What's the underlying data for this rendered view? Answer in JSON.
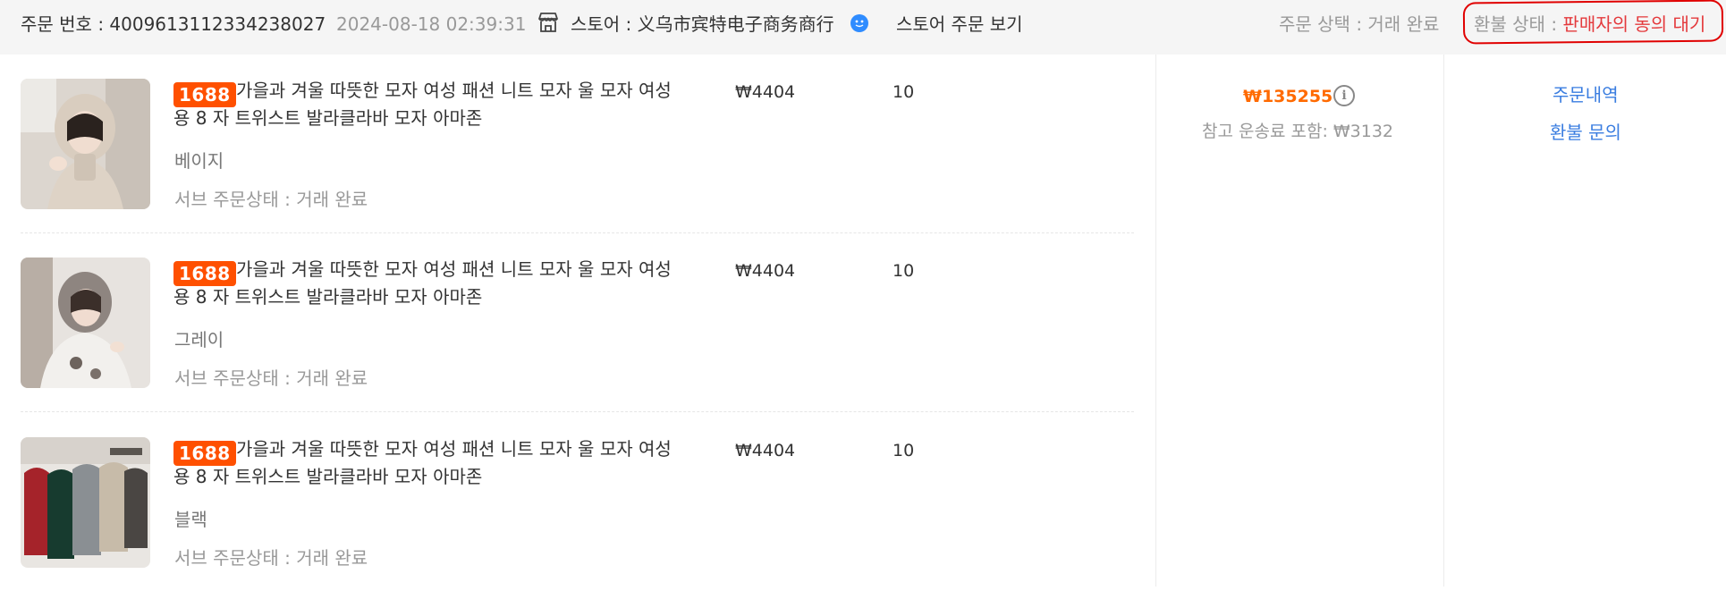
{
  "header": {
    "order_no": "주문 번호 : 4009613112334238027",
    "order_time": "2024-08-18 02:39:31",
    "store_prefix": "스토어 : ",
    "store_name": "义乌市宾特电子商务商行",
    "view_store_orders": "스토어 주문 보기",
    "order_status": "주문 상택 : 거래 완료",
    "refund_status_label": "환불 상태 : ",
    "refund_status_value": "판매자의 동의 대기",
    "icons": {
      "store": "store-icon",
      "chat": "chat-icon"
    },
    "colors": {
      "refund_value": "#e4393c",
      "highlight_ring": "#e00000"
    }
  },
  "items": [
    {
      "badge": "1688",
      "title": "가을과 겨울 따뜻한 모자 여성 패션 니트 모자 울 모자 여성용 8 자 트위스트 발라클라바 모자 아마존",
      "price": "₩4404",
      "qty": "10",
      "variant": "베이지",
      "sub_status": "서브 주문상태 : 거래 완료"
    },
    {
      "badge": "1688",
      "title": "가을과 겨울 따뜻한 모자 여성 패션 니트 모자 울 모자 여성용 8 자 트위스트 발라클라바 모자 아마존",
      "price": "₩4404",
      "qty": "10",
      "variant": "그레이",
      "sub_status": "서브 주문상태 : 거래 완료"
    },
    {
      "badge": "1688",
      "title": "가을과 겨울 따뜻한 모자 여성 패션 니트 모자 울 모자 여성용 8 자 트위스트 발라클라바 모자 아마존",
      "price": "₩4404",
      "qty": "10",
      "variant": "블랙",
      "sub_status": "서브 주문상태 : 거래 완료"
    }
  ],
  "summary": {
    "total": "₩135255",
    "shipping": "참고 운송료 포함: ₩3132",
    "info_icon": "info-icon",
    "total_color": "#ff6a00"
  },
  "actions": {
    "order_details": "주문내역",
    "refund_inquiry": "환불 문의",
    "link_color": "#3a7de0"
  }
}
